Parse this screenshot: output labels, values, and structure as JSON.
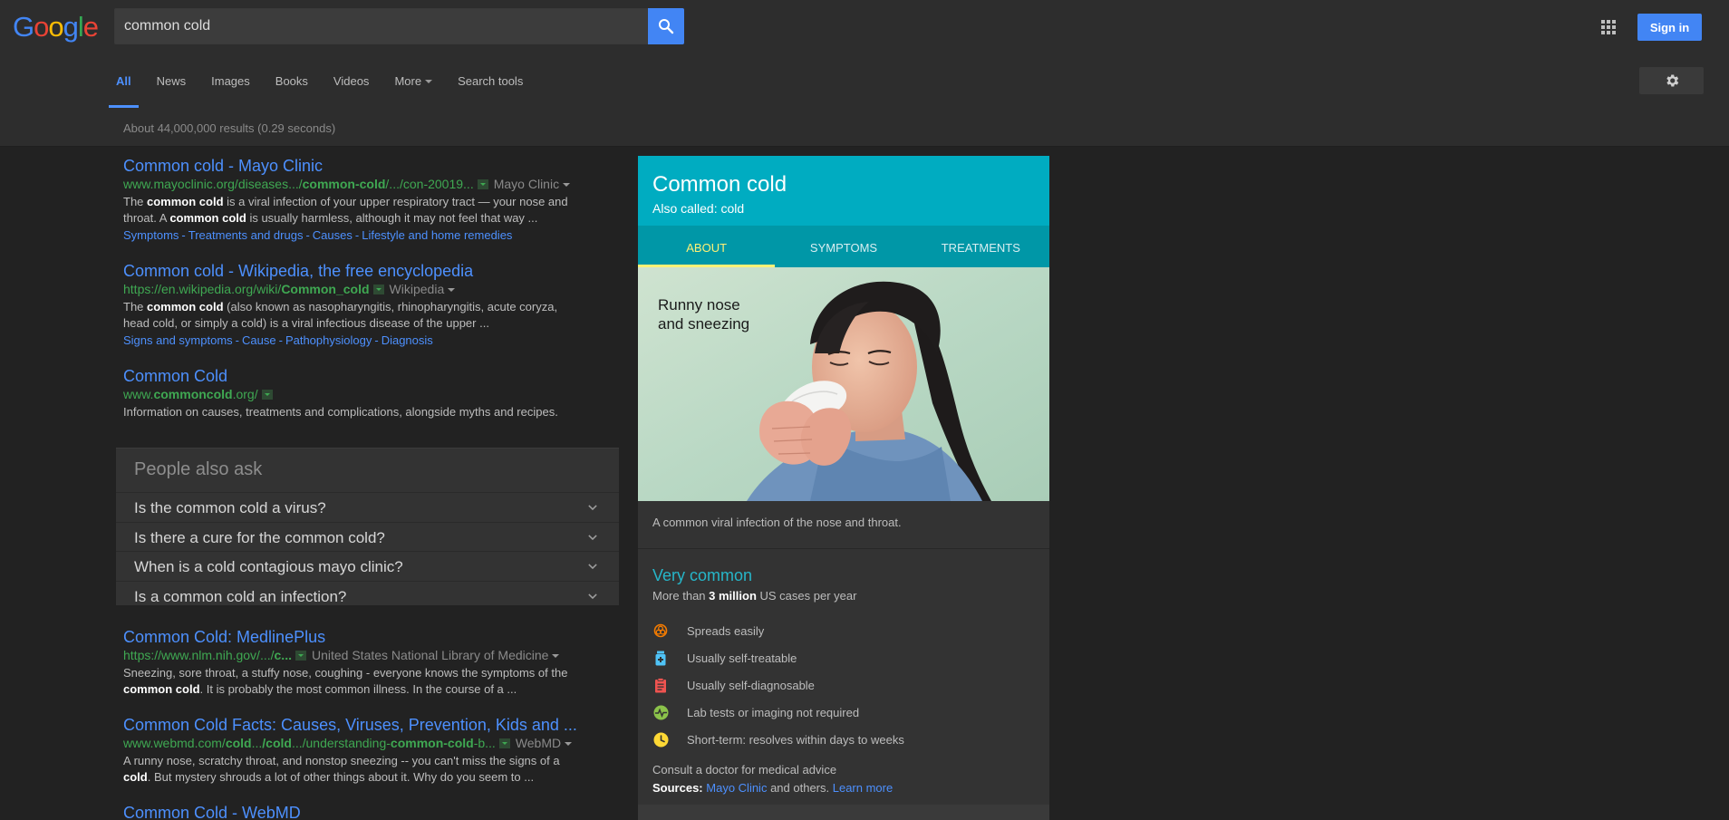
{
  "header": {
    "logo": {
      "letters": [
        "G",
        "o",
        "o",
        "g",
        "l",
        "e"
      ],
      "colors": [
        "#4285f4",
        "#ea4335",
        "#fbbc05",
        "#4285f4",
        "#34a853",
        "#ea4335"
      ]
    },
    "search": {
      "value": "common cold",
      "button_icon": "search-icon"
    },
    "apps_icon": "apps-grid-icon",
    "signin_label": "Sign in",
    "settings_icon": "gear-icon"
  },
  "tabs": [
    {
      "label": "All",
      "active": true
    },
    {
      "label": "News"
    },
    {
      "label": "Images"
    },
    {
      "label": "Books"
    },
    {
      "label": "Videos"
    },
    {
      "label": "More",
      "dropdown": true
    },
    {
      "label": "Search tools"
    }
  ],
  "stats": "About 44,000,000 results (0.29 seconds)",
  "results": [
    {
      "title": "Common cold - Mayo Clinic",
      "url_parts": [
        [
          "www.mayoclinic.org/diseases.../",
          false
        ],
        [
          "common-cold",
          true
        ],
        [
          "/.../con-20019...",
          false
        ]
      ],
      "site": "Mayo Clinic",
      "snippet_parts": [
        [
          "The ",
          false
        ],
        [
          "common cold",
          true
        ],
        [
          " is a viral infection of your upper respiratory tract — your nose and throat. A ",
          false
        ],
        [
          "common cold",
          true
        ],
        [
          " is usually harmless, although it may not feel that way ...",
          false
        ]
      ],
      "links": [
        "Symptoms",
        "Treatments and drugs",
        "Causes",
        "Lifestyle and home remedies"
      ]
    },
    {
      "title": "Common cold - Wikipedia, the free encyclopedia",
      "url_parts": [
        [
          "https://en.wikipedia.org/wiki/",
          false
        ],
        [
          "Common_cold",
          true
        ]
      ],
      "site": "Wikipedia",
      "snippet_parts": [
        [
          "The ",
          false
        ],
        [
          "common cold",
          true
        ],
        [
          " (also known as nasopharyngitis, rhinopharyngitis, acute coryza, head cold, or simply a cold) is a viral infectious disease of the upper ...",
          false
        ]
      ],
      "links": [
        "Signs and symptoms",
        "Cause",
        "Pathophysiology",
        "Diagnosis"
      ]
    },
    {
      "title": "Common Cold",
      "url_parts": [
        [
          "www.",
          false
        ],
        [
          "commoncold",
          true
        ],
        [
          ".org/",
          false
        ]
      ],
      "site": "",
      "snippet_parts": [
        [
          "Information on causes, treatments and complications, alongside myths and recipes.",
          false
        ]
      ],
      "links": []
    }
  ],
  "people_also_ask": {
    "title": "People also ask",
    "questions": [
      "Is the common cold a virus?",
      "Is there a cure for the common cold?",
      "When is a cold contagious mayo clinic?",
      "Is a common cold an infection?"
    ]
  },
  "results2": [
    {
      "title": "Common Cold: MedlinePlus",
      "url_parts": [
        [
          "https://www.nlm.nih.gov/.../",
          false
        ],
        [
          "c...",
          true
        ]
      ],
      "site": "United States National Library of Medicine",
      "snippet_parts": [
        [
          "Sneezing, sore throat, a stuffy nose, coughing - everyone knows the symptoms of the ",
          false
        ],
        [
          "common cold",
          true
        ],
        [
          ". It is probably the most common illness. In the course of a ...",
          false
        ]
      ],
      "links": []
    },
    {
      "title": "Common Cold Facts: Causes, Viruses, Prevention, Kids and ...",
      "url_parts": [
        [
          "www.webmd.com/",
          false
        ],
        [
          "cold",
          true
        ],
        [
          "...",
          false
        ],
        [
          "/cold",
          true
        ],
        [
          ".../understanding-",
          false
        ],
        [
          "common-cold",
          true
        ],
        [
          "-b...",
          false
        ]
      ],
      "site": "WebMD",
      "snippet_parts": [
        [
          "A runny nose, scratchy throat, and nonstop sneezing -- you can't miss the signs of a ",
          false
        ],
        [
          "cold",
          true
        ],
        [
          ". But mystery shrouds a lot of other things about it. Why do you seem to ...",
          false
        ]
      ],
      "links": []
    },
    {
      "title": "Common Cold - WebMD",
      "url_parts": [],
      "site": "",
      "snippet_parts": [],
      "links": []
    }
  ],
  "knowledge_panel": {
    "title": "Common cold",
    "also_called": "Also called: cold",
    "tabs": [
      "ABOUT",
      "SYMPTOMS",
      "TREATMENTS"
    ],
    "active_tab": 0,
    "illustration_caption": [
      "Runny nose",
      "and sneezing"
    ],
    "description": "A common viral infection of the nose and throat.",
    "frequency": "Very common",
    "cases": {
      "prefix": "More than ",
      "value": "3 million",
      "suffix": " US cases per year"
    },
    "features": [
      {
        "icon": "biohazard-icon",
        "label": "Spreads easily",
        "color": "#f57c00"
      },
      {
        "icon": "medicine-bottle-icon",
        "label": "Usually self-treatable",
        "color": "#4fc3f7"
      },
      {
        "icon": "clipboard-icon",
        "label": "Usually self-diagnosable",
        "color": "#ef5350"
      },
      {
        "icon": "pulse-icon",
        "label": "Lab tests or imaging not required",
        "color": "#8bc34a"
      },
      {
        "icon": "clock-icon",
        "label": "Short-term: resolves within days to weeks",
        "color": "#fdd835"
      }
    ],
    "consult": "Consult a doctor for medical advice",
    "sources": {
      "label": "Sources:",
      "link": "Mayo Clinic",
      "middle": " and others.",
      "learn_more": "Learn more"
    }
  },
  "colors": {
    "link": "#4d90fe",
    "url_green": "#3fa852",
    "panel_teal": "#00acc1",
    "panel_tab_bg": "#0097a7",
    "active_tab_accent": "#fff176",
    "header_bg": "#2d2d2d",
    "body_bg": "#222222"
  }
}
